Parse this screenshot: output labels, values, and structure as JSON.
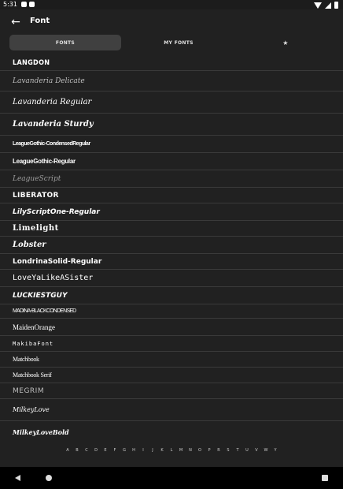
{
  "status": {
    "time": "5:31"
  },
  "appbar": {
    "title": "Font",
    "back_icon": "arrow-left-icon"
  },
  "tabs": [
    {
      "label": "FONTS",
      "active": true
    },
    {
      "label": "MY FONTS",
      "active": false
    },
    {
      "label": "★",
      "active": false
    }
  ],
  "fonts": [
    "LANGDON",
    "Lavanderia Delicate",
    "Lavanderia Regular",
    "Lavanderia Sturdy",
    "LeagueGothic-CondensedRegular",
    "LeagueGothic-Regular",
    "LeagueScript",
    "LIBERATOR",
    "LilyScriptOne-Regular",
    "Limelight",
    "Lobster",
    "LondrinaSolid-Regular",
    "LoveYaLikeASister",
    "LUCKIESTGUY",
    "MADINA-BLACKCONDENSED",
    "MaidenOrange",
    "MakibaFont",
    "Matchbook",
    "Matchbook Serif",
    "MEGRIM",
    "MilkeyLove",
    "MilkeyLoveBold"
  ],
  "alphabet": [
    "A",
    "B",
    "C",
    "D",
    "E",
    "F",
    "G",
    "H",
    "I",
    "J",
    "K",
    "L",
    "M",
    "N",
    "O",
    "P",
    "R",
    "S",
    "T",
    "U",
    "V",
    "W",
    "Y"
  ]
}
